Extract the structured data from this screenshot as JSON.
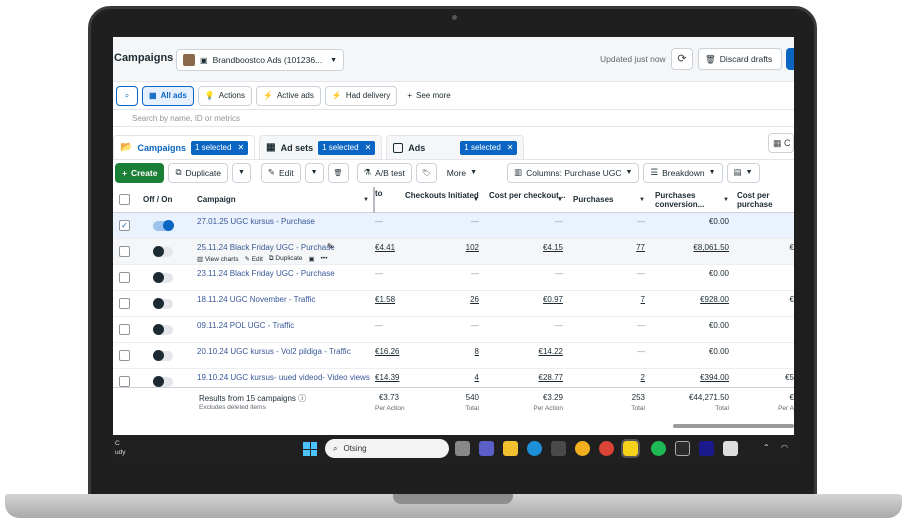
{
  "header": {
    "title": "Campaigns",
    "account": "Brandboostco Ads (101236...",
    "updated": "Updated just now",
    "discard": "Discard drafts"
  },
  "filters": {
    "all_ads": "All ads",
    "actions": "Actions",
    "active_ads": "Active ads",
    "had_delivery": "Had delivery",
    "see_more": "See more",
    "search_placeholder": "Search by name, ID or metrics"
  },
  "tabs": [
    {
      "label": "Campaigns",
      "selected": "1 selected"
    },
    {
      "label": "Ad sets",
      "selected": "1 selected"
    },
    {
      "label": "Ads",
      "selected": "1 selected"
    }
  ],
  "tab_right_label": "C",
  "toolbar": {
    "create": "Create",
    "duplicate": "Duplicate",
    "edit": "Edit",
    "ab_test": "A/B test",
    "more": "More",
    "columns": "Columns: Purchase UGC",
    "breakdown": "Breakdown"
  },
  "table": {
    "headers": {
      "offon": "Off / On",
      "campaign": "Campaign",
      "to": "to",
      "checkouts": "Checkouts Initiated",
      "cost_checkout": "Cost per checkout...",
      "purchases": "Purchases",
      "purchases_value": "Purchases conversion...",
      "cost_purchase": "Cost per purchase"
    },
    "row_actions": {
      "view_charts": "View charts",
      "edit": "Edit",
      "duplicate": "Duplicate"
    },
    "rows": [
      {
        "name": "27.01.25 UGC kursus - Purchase",
        "to": "—",
        "checkouts": "—",
        "cost_checkout": "—",
        "purchases": "—",
        "value": "€0.00",
        "cpp": ""
      },
      {
        "name": "25.11.24 Black Friday UGC - Purchase",
        "to": "€4.41",
        "checkouts": "102",
        "cost_checkout": "€4.15",
        "purchases": "77",
        "value": "€8,061.50",
        "cpp": "€"
      },
      {
        "name": "23.11.24 Black Friday UGC - Purchase",
        "to": "—",
        "checkouts": "—",
        "cost_checkout": "—",
        "purchases": "—",
        "value": "€0.00",
        "cpp": ""
      },
      {
        "name": "18.11.24 UGC November - Traffic",
        "to": "€1.58",
        "checkouts": "26",
        "cost_checkout": "€0.97",
        "purchases": "7",
        "value": "€928.00",
        "cpp": "€"
      },
      {
        "name": "09.11.24 POL UGC - Traffic",
        "to": "—",
        "checkouts": "—",
        "cost_checkout": "—",
        "purchases": "—",
        "value": "€0.00",
        "cpp": ""
      },
      {
        "name": "20.10.24 UGC kursus - Vol2 pildiga - Traffic",
        "to": "€16.26",
        "checkouts": "8",
        "cost_checkout": "€14.22",
        "purchases": "—",
        "value": "€0.00",
        "cpp": ""
      },
      {
        "name": "19.10.24 UGC kursus- uued videod- Video views",
        "to": "€14.39",
        "checkouts": "4",
        "cost_checkout": "€28.77",
        "purchases": "2",
        "value": "€394.00",
        "cpp": "€5"
      }
    ],
    "summary": {
      "title": "Results from 15 campaigns",
      "sub": "Excludes deleted items",
      "to": "€3.73",
      "to_l": "Per Action",
      "checkouts": "540",
      "checkouts_l": "Total",
      "cost_checkout": "€3.29",
      "cost_checkout_l": "Per Action",
      "purchases": "253",
      "purchases_l": "Total",
      "value": "€44,271.50",
      "value_l": "Total",
      "cpp": "€",
      "cpp_l": "Per A"
    }
  },
  "taskbar": {
    "weather_top": "C",
    "weather_bottom": "udy",
    "search": "Otsing"
  },
  "colors": {
    "accent": "#0a66c2",
    "create": "#1a7f37"
  }
}
